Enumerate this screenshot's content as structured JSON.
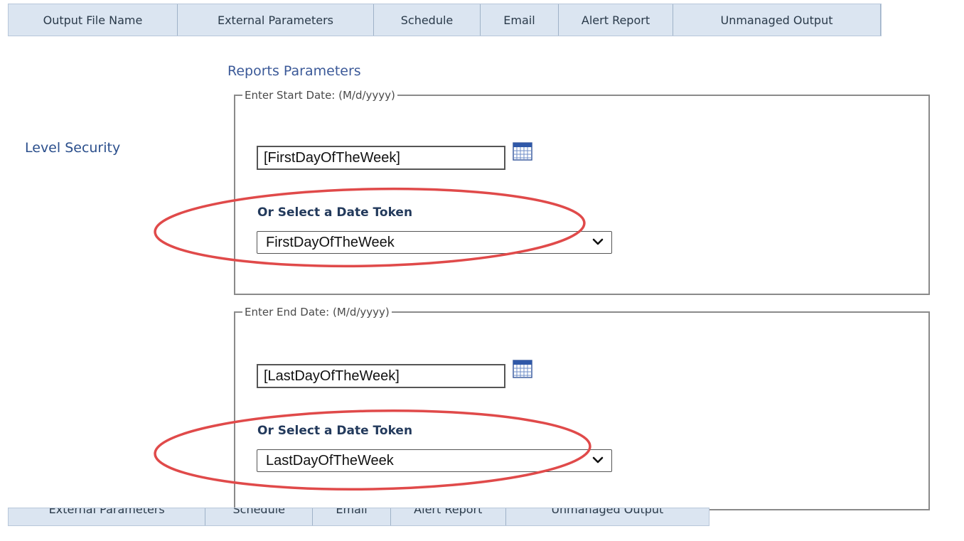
{
  "tabs_top": [
    {
      "label": "Output File Name"
    },
    {
      "label": "External Parameters"
    },
    {
      "label": "Schedule"
    },
    {
      "label": "Email"
    },
    {
      "label": "Alert Report"
    },
    {
      "label": "Unmanaged Output"
    }
  ],
  "tabs_bottom": [
    {
      "label": "External Parameters"
    },
    {
      "label": "Schedule"
    },
    {
      "label": "Email"
    },
    {
      "label": "Alert Report"
    },
    {
      "label": "Unmanaged Output"
    }
  ],
  "section_title": "Reports Parameters",
  "side_label": "Level Security",
  "start": {
    "legend": "Enter Start Date: (M/d/yyyy)",
    "input_value": "[FirstDayOfTheWeek]",
    "token_label": "Or Select a Date Token",
    "selected": "FirstDayOfTheWeek"
  },
  "end": {
    "legend": "Enter End Date: (M/d/yyyy)",
    "input_value": "[LastDayOfTheWeek]",
    "token_label": "Or Select a Date Token",
    "selected": "LastDayOfTheWeek"
  },
  "colors": {
    "tab_bg": "#dbe5f1",
    "title": "#3b5998",
    "annotation": "#e04a4a"
  },
  "icons": {
    "calendar": "calendar-icon",
    "dropdown": "chevron-down-icon"
  }
}
